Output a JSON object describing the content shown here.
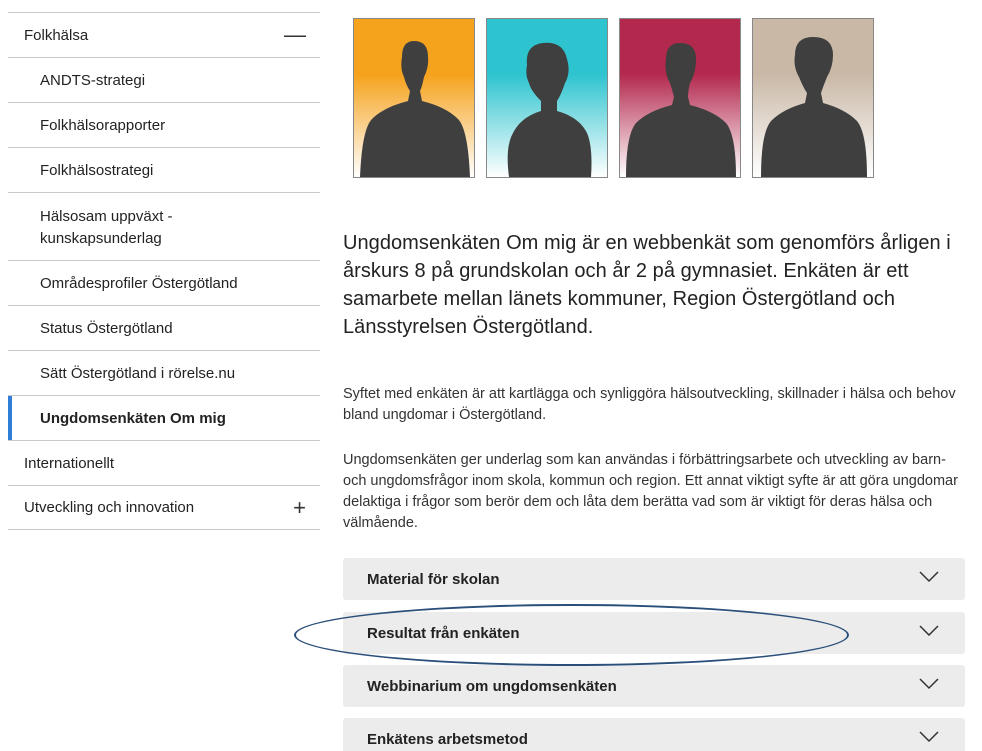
{
  "sidebar": {
    "items": [
      {
        "label": "Folkhälsa",
        "toggle": "—"
      },
      {
        "label": "ANDTS-strategi"
      },
      {
        "label": "Folkhälsorapporter"
      },
      {
        "label": "Folkhälsostrategi"
      },
      {
        "label": "Hälsosam uppväxt - kunskapsunderlag"
      },
      {
        "label": "Områdesprofiler Östergötland"
      },
      {
        "label": "Status Östergötland"
      },
      {
        "label": "Sätt Östergötland i rörelse.nu"
      },
      {
        "label": "Ungdomsenkäten Om mig"
      },
      {
        "label": "Internationellt"
      },
      {
        "label": "Utveckling och innovation",
        "toggle": "+"
      }
    ]
  },
  "main": {
    "portrait_colors": [
      {
        "top": "#f5a21c",
        "bottom": "#ffffff"
      },
      {
        "top": "#2ec4cf",
        "bottom": "#ffffff"
      },
      {
        "top": "#b3294e",
        "bottom": "#ffffff"
      },
      {
        "top": "#c9b8a6",
        "bottom": "#ffffff"
      }
    ],
    "lead": "Ungdomsenkäten Om mig är en webbenkät som genomförs årligen i årskurs 8 på grundskolan och år 2 på gymnasiet. Enkäten är ett samarbete mellan länets kommuner, Region Östergötland och Länsstyrelsen Östergötland.",
    "paragraph1": "Syftet med enkäten är att kartlägga och synliggöra hälsoutveckling, skillnader i hälsa och behov bland ungdomar i Östergötland.",
    "paragraph2": "Ungdomsenkäten ger underlag som kan användas i förbättringsarbete och utveckling av barn- och ungdomsfrågor inom skola, kommun och region. Ett annat viktigt syfte är att göra ungdomar delaktiga i frågor som berör dem och låta dem berätta vad som är viktigt för deras hälsa och välmående.",
    "accordions": [
      {
        "label": "Material för skolan"
      },
      {
        "label": "Resultat från enkäten"
      },
      {
        "label": "Webbinarium om ungdomsenkäten"
      },
      {
        "label": "Enkätens arbetsmetod"
      }
    ],
    "highlight_color": "#2a4f7a",
    "active_accent": "#2f7fd8"
  }
}
